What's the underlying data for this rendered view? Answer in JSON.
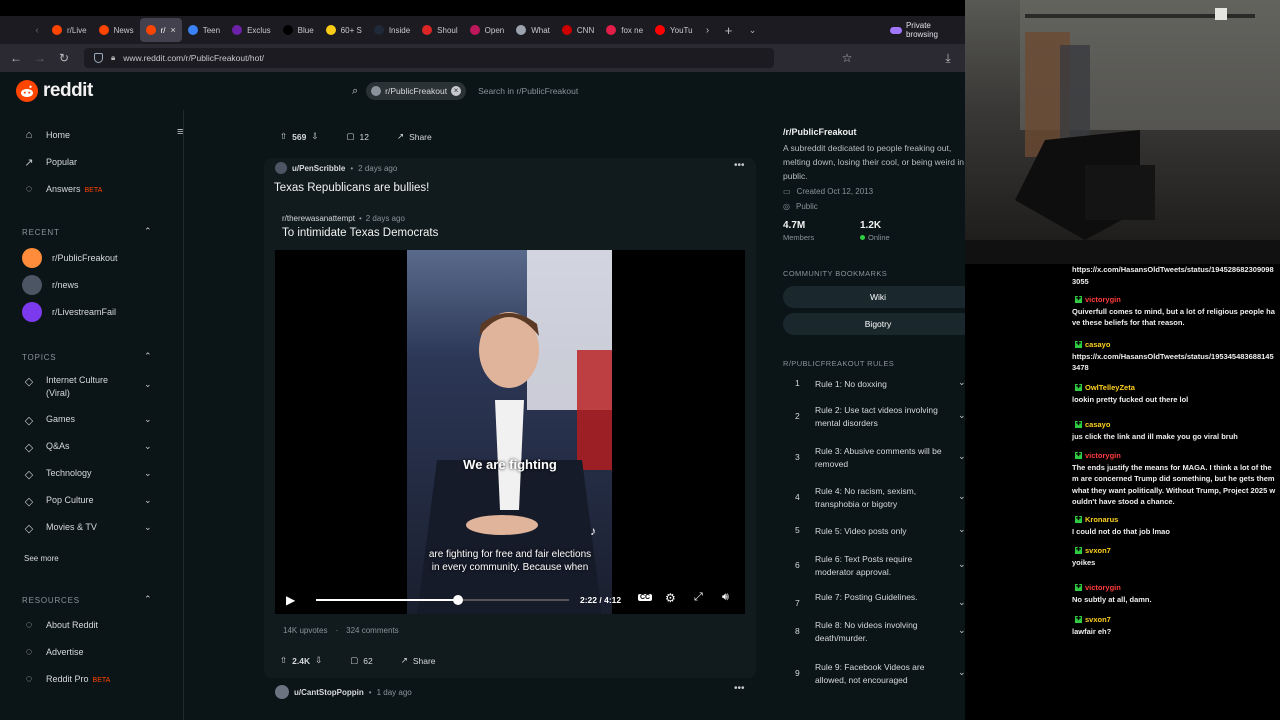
{
  "browser": {
    "tabs": [
      {
        "label": "r/Live",
        "color": "#ff4500"
      },
      {
        "label": "News",
        "color": "#ff4500"
      },
      {
        "label": "r/",
        "color": "#ff4500",
        "active": true
      },
      {
        "label": "Teen",
        "color": "#3b82f6"
      },
      {
        "label": "Exclus",
        "color": "#6b21a8"
      },
      {
        "label": "Blue",
        "color": "#000000"
      },
      {
        "label": "60+ S",
        "color": "#facc15"
      },
      {
        "label": "Inside",
        "color": "#1f2937"
      },
      {
        "label": "Shoul",
        "color": "#dc2626"
      },
      {
        "label": "Open",
        "color": "#be185d"
      },
      {
        "label": "What",
        "color": "#9ca3af"
      },
      {
        "label": "CNN",
        "color": "#cc0000"
      },
      {
        "label": "fox ne",
        "color": "#e11d48"
      },
      {
        "label": "YouTu",
        "color": "#ff0000"
      }
    ],
    "private_label": "Private browsing",
    "url": "www.reddit.com/r/PublicFreakout/hot/"
  },
  "reddit": {
    "logo": "reddit",
    "search_chip": "r/PublicFreakout",
    "search_placeholder": "Search in r/PublicFreakout",
    "nav": [
      {
        "label": "Home",
        "icon": "home-icon"
      },
      {
        "label": "Popular",
        "icon": "popular-icon"
      },
      {
        "label": "Answers",
        "icon": "answers-icon",
        "badge": "BETA"
      }
    ],
    "recent_header": "RECENT",
    "recent": [
      {
        "label": "r/PublicFreakout",
        "color": "#ff8c3a"
      },
      {
        "label": "r/news",
        "color": "#4b5563"
      },
      {
        "label": "r/LivestreamFail",
        "color": "#7c3aed"
      }
    ],
    "topics_header": "TOPICS",
    "topics": [
      "Internet Culture (Viral)",
      "Games",
      "Q&As",
      "Technology",
      "Pop Culture",
      "Movies & TV"
    ],
    "see_more": "See more",
    "resources_header": "RESOURCES",
    "resources": [
      {
        "label": "About Reddit"
      },
      {
        "label": "Advertise"
      },
      {
        "label": "Reddit Pro",
        "badge": "BETA"
      }
    ]
  },
  "feed": {
    "prev_post": {
      "votes": "569",
      "comments": "12",
      "share": "Share"
    },
    "post": {
      "author": "u/PenScribble",
      "age": "2 days ago",
      "title": "Texas Republicans are bullies!",
      "crosspost_sub": "r/therewasanattempt",
      "crosspost_age": "2 days ago",
      "crosspost_title": "To intimidate Texas Democrats",
      "caption_big": "We are fighting",
      "caption_line1": "are fighting for free and fair elections",
      "caption_line2": "in every community. Because when",
      "time": "2:22 / 4:12",
      "progress": 0.56,
      "upvotes_text": "14K upvotes",
      "comments_text": "324 comments",
      "votes": "2.4K",
      "comments": "62",
      "share": "Share"
    },
    "next_post": {
      "author": "u/CantStopPoppin",
      "age": "1 day ago"
    }
  },
  "community": {
    "name": "/r/PublicFreakout",
    "description": "A subreddit dedicated to people freaking out, melting down, losing their cool, or being weird in public.",
    "created": "Created Oct 12, 2013",
    "visibility": "Public",
    "members": "4.7M",
    "members_label": "Members",
    "online": "1.2K",
    "online_label": "Online",
    "bookmarks_header": "COMMUNITY BOOKMARKS",
    "bookmarks": [
      "Wiki",
      "Bigotry"
    ],
    "rules_header": "R/PUBLICFREAKOUT RULES",
    "rules": [
      "Rule 1: No doxxing",
      "Rule 2: Use tact videos involving mental disorders",
      "Rule 3: Abusive comments will be removed",
      "Rule 4: No racism, sexism, transphobia or bigotry",
      "Rule 5: Video posts only",
      "Rule 6: Text Posts require moderator approval.",
      "Rule 7: Posting Guidelines.",
      "Rule 8: No videos involving death/murder.",
      "Rule 9: Facebook Videos are allowed, not encouraged"
    ]
  },
  "chat": [
    {
      "user": "",
      "text": "https://x.com/HasansOldTweets/status/1945286823090983055"
    },
    {
      "user": "victorygin",
      "color": "#ff3b3b",
      "text": "Quiverfull comes to mind, but a lot of religious people have these beliefs for that reason."
    },
    {
      "user": "casayo",
      "color": "#ffd21f",
      "text": "https://x.com/HasansOldTweets/status/1953454836881453478"
    },
    {
      "user": "OwlTelleyZeta",
      "color": "#ffd21f",
      "text": "lookin pretty fucked out there lol"
    },
    {
      "user": "casayo",
      "color": "#ffd21f",
      "text": "jus click the link and ill make you go viral bruh"
    },
    {
      "user": "victorygin",
      "color": "#ff3b3b",
      "text": "The ends justify the means for MAGA. I think a lot of them are concerned Trump did something, but he gets them what they want politically. Without Trump, Project 2025 wouldn't have stood a chance."
    },
    {
      "user": "Kronarus",
      "color": "#ffd21f",
      "text": "I could not do that job lmao"
    },
    {
      "user": "svxon7",
      "color": "#ffd21f",
      "text": "yoikes"
    },
    {
      "user": "victorygin",
      "color": "#ff3b3b",
      "text": "No subtly at all, damn."
    },
    {
      "user": "svxon7",
      "color": "#ffd21f",
      "text": "lawfair eh?"
    }
  ]
}
